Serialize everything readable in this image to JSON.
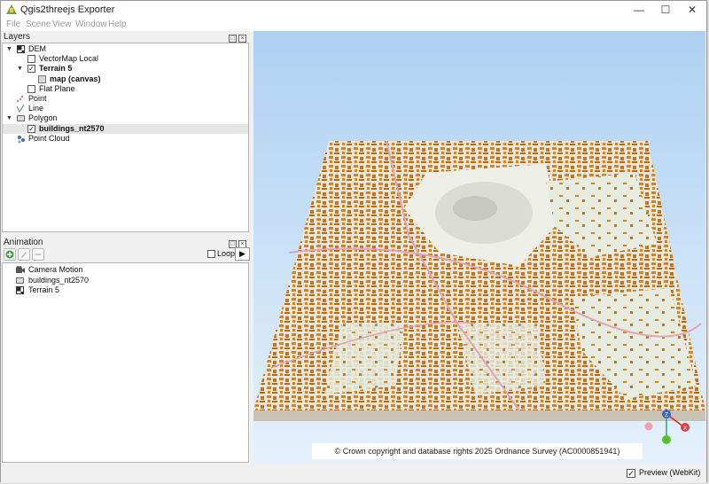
{
  "window": {
    "title": "Qgis2threejs Exporter"
  },
  "menu": [
    "File",
    "Scene",
    "View",
    "Window",
    "Help"
  ],
  "layers_panel": {
    "title": "Layers",
    "items": [
      {
        "label": "DEM",
        "level": 0,
        "arrow": "▼",
        "checkbox": false,
        "checked": false,
        "icon": "dem-grid-icon",
        "bold": false
      },
      {
        "label": "VectorMap Local",
        "level": 1,
        "arrow": "",
        "checkbox": true,
        "checked": false,
        "icon": "",
        "bold": false
      },
      {
        "label": "Terrain 5",
        "level": 1,
        "arrow": "▼",
        "checkbox": true,
        "checked": true,
        "icon": "",
        "bold": true
      },
      {
        "label": "map (canvas)",
        "level": 2,
        "arrow": "",
        "checkbox": false,
        "checked": false,
        "icon": "map-layer-icon",
        "bold": true
      },
      {
        "label": "Flat Plane",
        "level": 1,
        "arrow": "",
        "checkbox": true,
        "checked": false,
        "icon": "",
        "bold": false
      },
      {
        "label": "Point",
        "level": 0,
        "arrow": "",
        "checkbox": false,
        "checked": false,
        "icon": "point-icon",
        "bold": false
      },
      {
        "label": "Line",
        "level": 0,
        "arrow": "",
        "checkbox": false,
        "checked": false,
        "icon": "line-icon",
        "bold": false
      },
      {
        "label": "Polygon",
        "level": 0,
        "arrow": "▼",
        "checkbox": false,
        "checked": false,
        "icon": "polygon-icon",
        "bold": false
      },
      {
        "label": "buildings_nt2570",
        "level": 1,
        "arrow": "",
        "checkbox": true,
        "checked": true,
        "icon": "",
        "bold": true,
        "selected": true
      },
      {
        "label": "Point Cloud",
        "level": 0,
        "arrow": "",
        "checkbox": false,
        "checked": false,
        "icon": "point-cloud-icon",
        "bold": false
      }
    ]
  },
  "animation_panel": {
    "title": "Animation",
    "loop_label": "Loop",
    "loop_checked": false,
    "play_icon": "▶",
    "items": [
      {
        "label": "Camera Motion",
        "icon": "camera-icon"
      },
      {
        "label": "buildings_nt2570",
        "icon": "polygon-icon"
      },
      {
        "label": "Terrain 5",
        "icon": "dem-grid-icon"
      }
    ]
  },
  "view": {
    "copyright": "© Crown copyright and database rights 2025 Ordnance Survey (AC0000851941)",
    "axes": {
      "z": "Z",
      "x": "X"
    },
    "colors": {
      "building": "#d9821c",
      "terrain": "#e8e6dc",
      "green": "#c6e3c0",
      "road": "#e0a4b8"
    }
  },
  "status": {
    "preview_label": "Preview (WebKit)",
    "preview_checked": true
  }
}
